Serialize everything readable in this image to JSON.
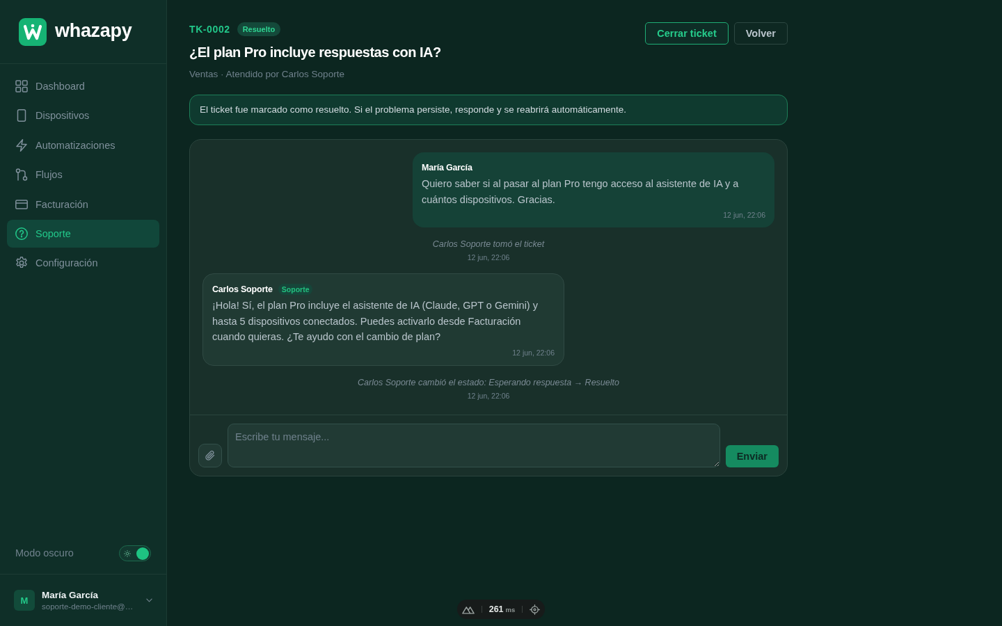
{
  "sidebar": {
    "brand": "whazapy",
    "nav_items": [
      {
        "label": "Dashboard",
        "selected": false
      },
      {
        "label": "Dispositivos",
        "selected": false
      },
      {
        "label": "Automatizaciones",
        "selected": false
      },
      {
        "label": "Flujos",
        "selected": false
      },
      {
        "label": "Facturación",
        "selected": false
      },
      {
        "label": "Soporte",
        "selected": true
      },
      {
        "label": "Configuración",
        "selected": false
      }
    ],
    "theme_toggle": {
      "label": "Modo oscuro",
      "on": true
    },
    "user": {
      "initial": "M",
      "name": "María García",
      "email": "soporte-demo-cliente@…"
    }
  },
  "ticket": {
    "id": "TK-0002",
    "status": "Resuelto",
    "title": "¿El plan Pro incluye respuestas con IA?",
    "meta": "Ventas · Atendido por Carlos Soporte",
    "actions": [
      {
        "label": "Cerrar ticket",
        "kind": "primary"
      },
      {
        "label": "Volver",
        "kind": "secondary"
      }
    ],
    "notice": "El ticket fue marcado como resuelto. Si el problema persiste, responde y se reabrirá automáticamente."
  },
  "messages": [
    {
      "kind": "customer",
      "author": "María García",
      "text": "Quiero saber si al pasar al plan Pro tengo acceso al asistente de IA y a cuántos dispositivos. Gracias.",
      "time": "12 jun, 22:06"
    },
    {
      "kind": "event",
      "text": "Carlos Soporte tomó el ticket",
      "time": "12 jun, 22:06"
    },
    {
      "kind": "agent",
      "author": "Carlos Soporte",
      "role": "Soporte",
      "text": "¡Hola! Sí, el plan Pro incluye el asistente de IA (Claude, GPT o Gemini) y hasta 5 dispositivos conectados. Puedes activarlo desde Facturación cuando quieras. ¿Te ayudo con el cambio de plan?",
      "time": "12 jun, 22:06"
    },
    {
      "kind": "event",
      "text": "Carlos Soporte cambió el estado: Esperando respuesta → Resuelto",
      "time": "12 jun, 22:06"
    }
  ],
  "composer": {
    "placeholder": "Escribe tu mensaje...",
    "send_label": "Enviar"
  },
  "devtools": {
    "timing": "261",
    "unit": "ms"
  }
}
